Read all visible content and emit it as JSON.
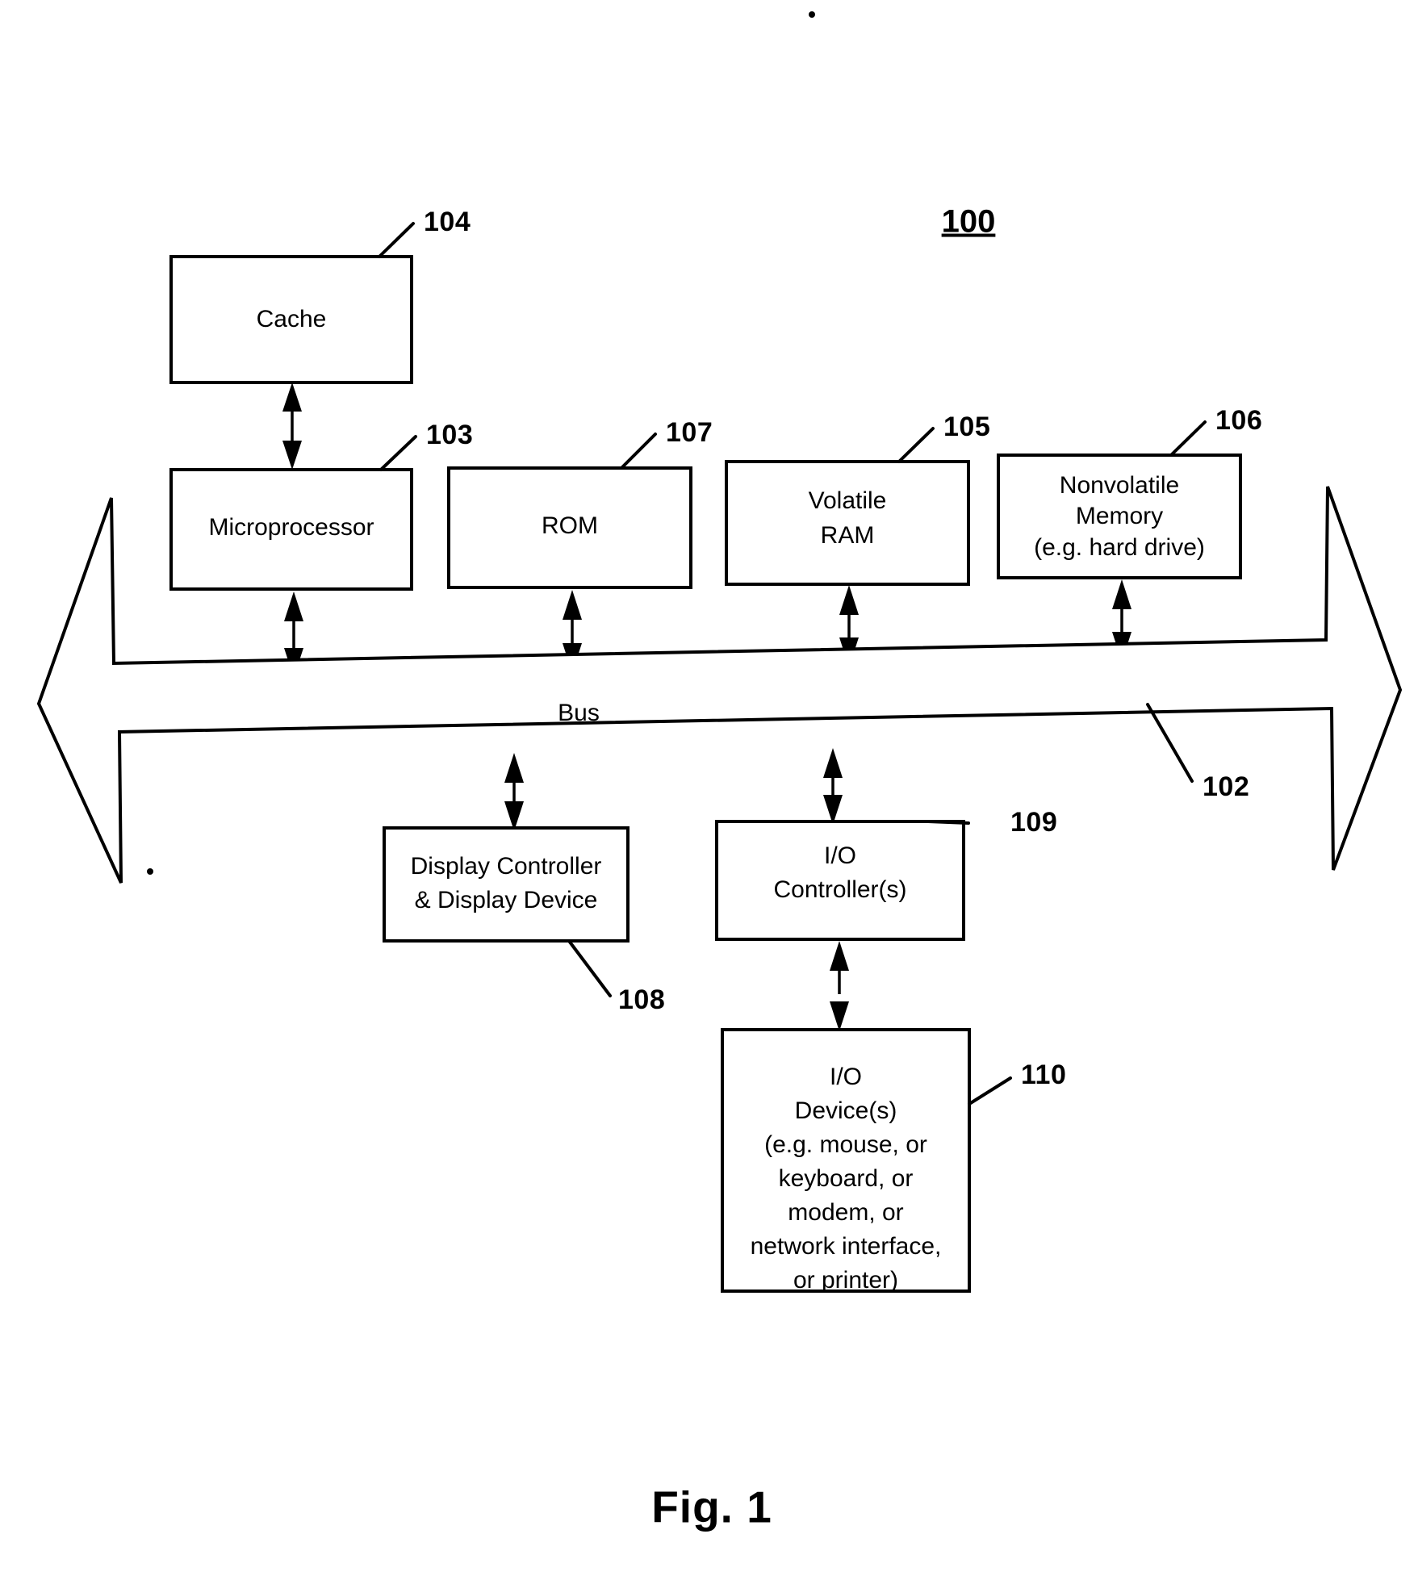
{
  "figure": {
    "caption": "Fig. 1",
    "system_ref": "100"
  },
  "blocks": [
    {
      "id": "cache",
      "label_lines": [
        "Cache"
      ],
      "ref": "104"
    },
    {
      "id": "microprocessor",
      "label_lines": [
        "Microprocessor"
      ],
      "ref": "103"
    },
    {
      "id": "rom",
      "label_lines": [
        "ROM"
      ],
      "ref": "107"
    },
    {
      "id": "volatile-ram",
      "label_lines": [
        "Volatile",
        "RAM"
      ],
      "ref": "105"
    },
    {
      "id": "nonvolatile-memory",
      "label_lines": [
        "Nonvolatile",
        "Memory",
        "(e.g. hard drive)"
      ],
      "ref": "106"
    },
    {
      "id": "display-controller",
      "label_lines": [
        "Display Controller",
        "& Display Device"
      ],
      "ref": "108"
    },
    {
      "id": "io-controller",
      "label_lines": [
        "I/O",
        "Controller(s)"
      ],
      "ref": "109"
    },
    {
      "id": "io-device",
      "label_lines": [
        "I/O",
        "Device(s)",
        "(e.g. mouse, or",
        "keyboard, or",
        "modem, or",
        "network interface,",
        "or printer)"
      ],
      "ref": "110"
    }
  ],
  "bus": {
    "label": "Bus",
    "ref": "102"
  },
  "colors": {
    "ink": "#000000",
    "paper": "#ffffff"
  }
}
